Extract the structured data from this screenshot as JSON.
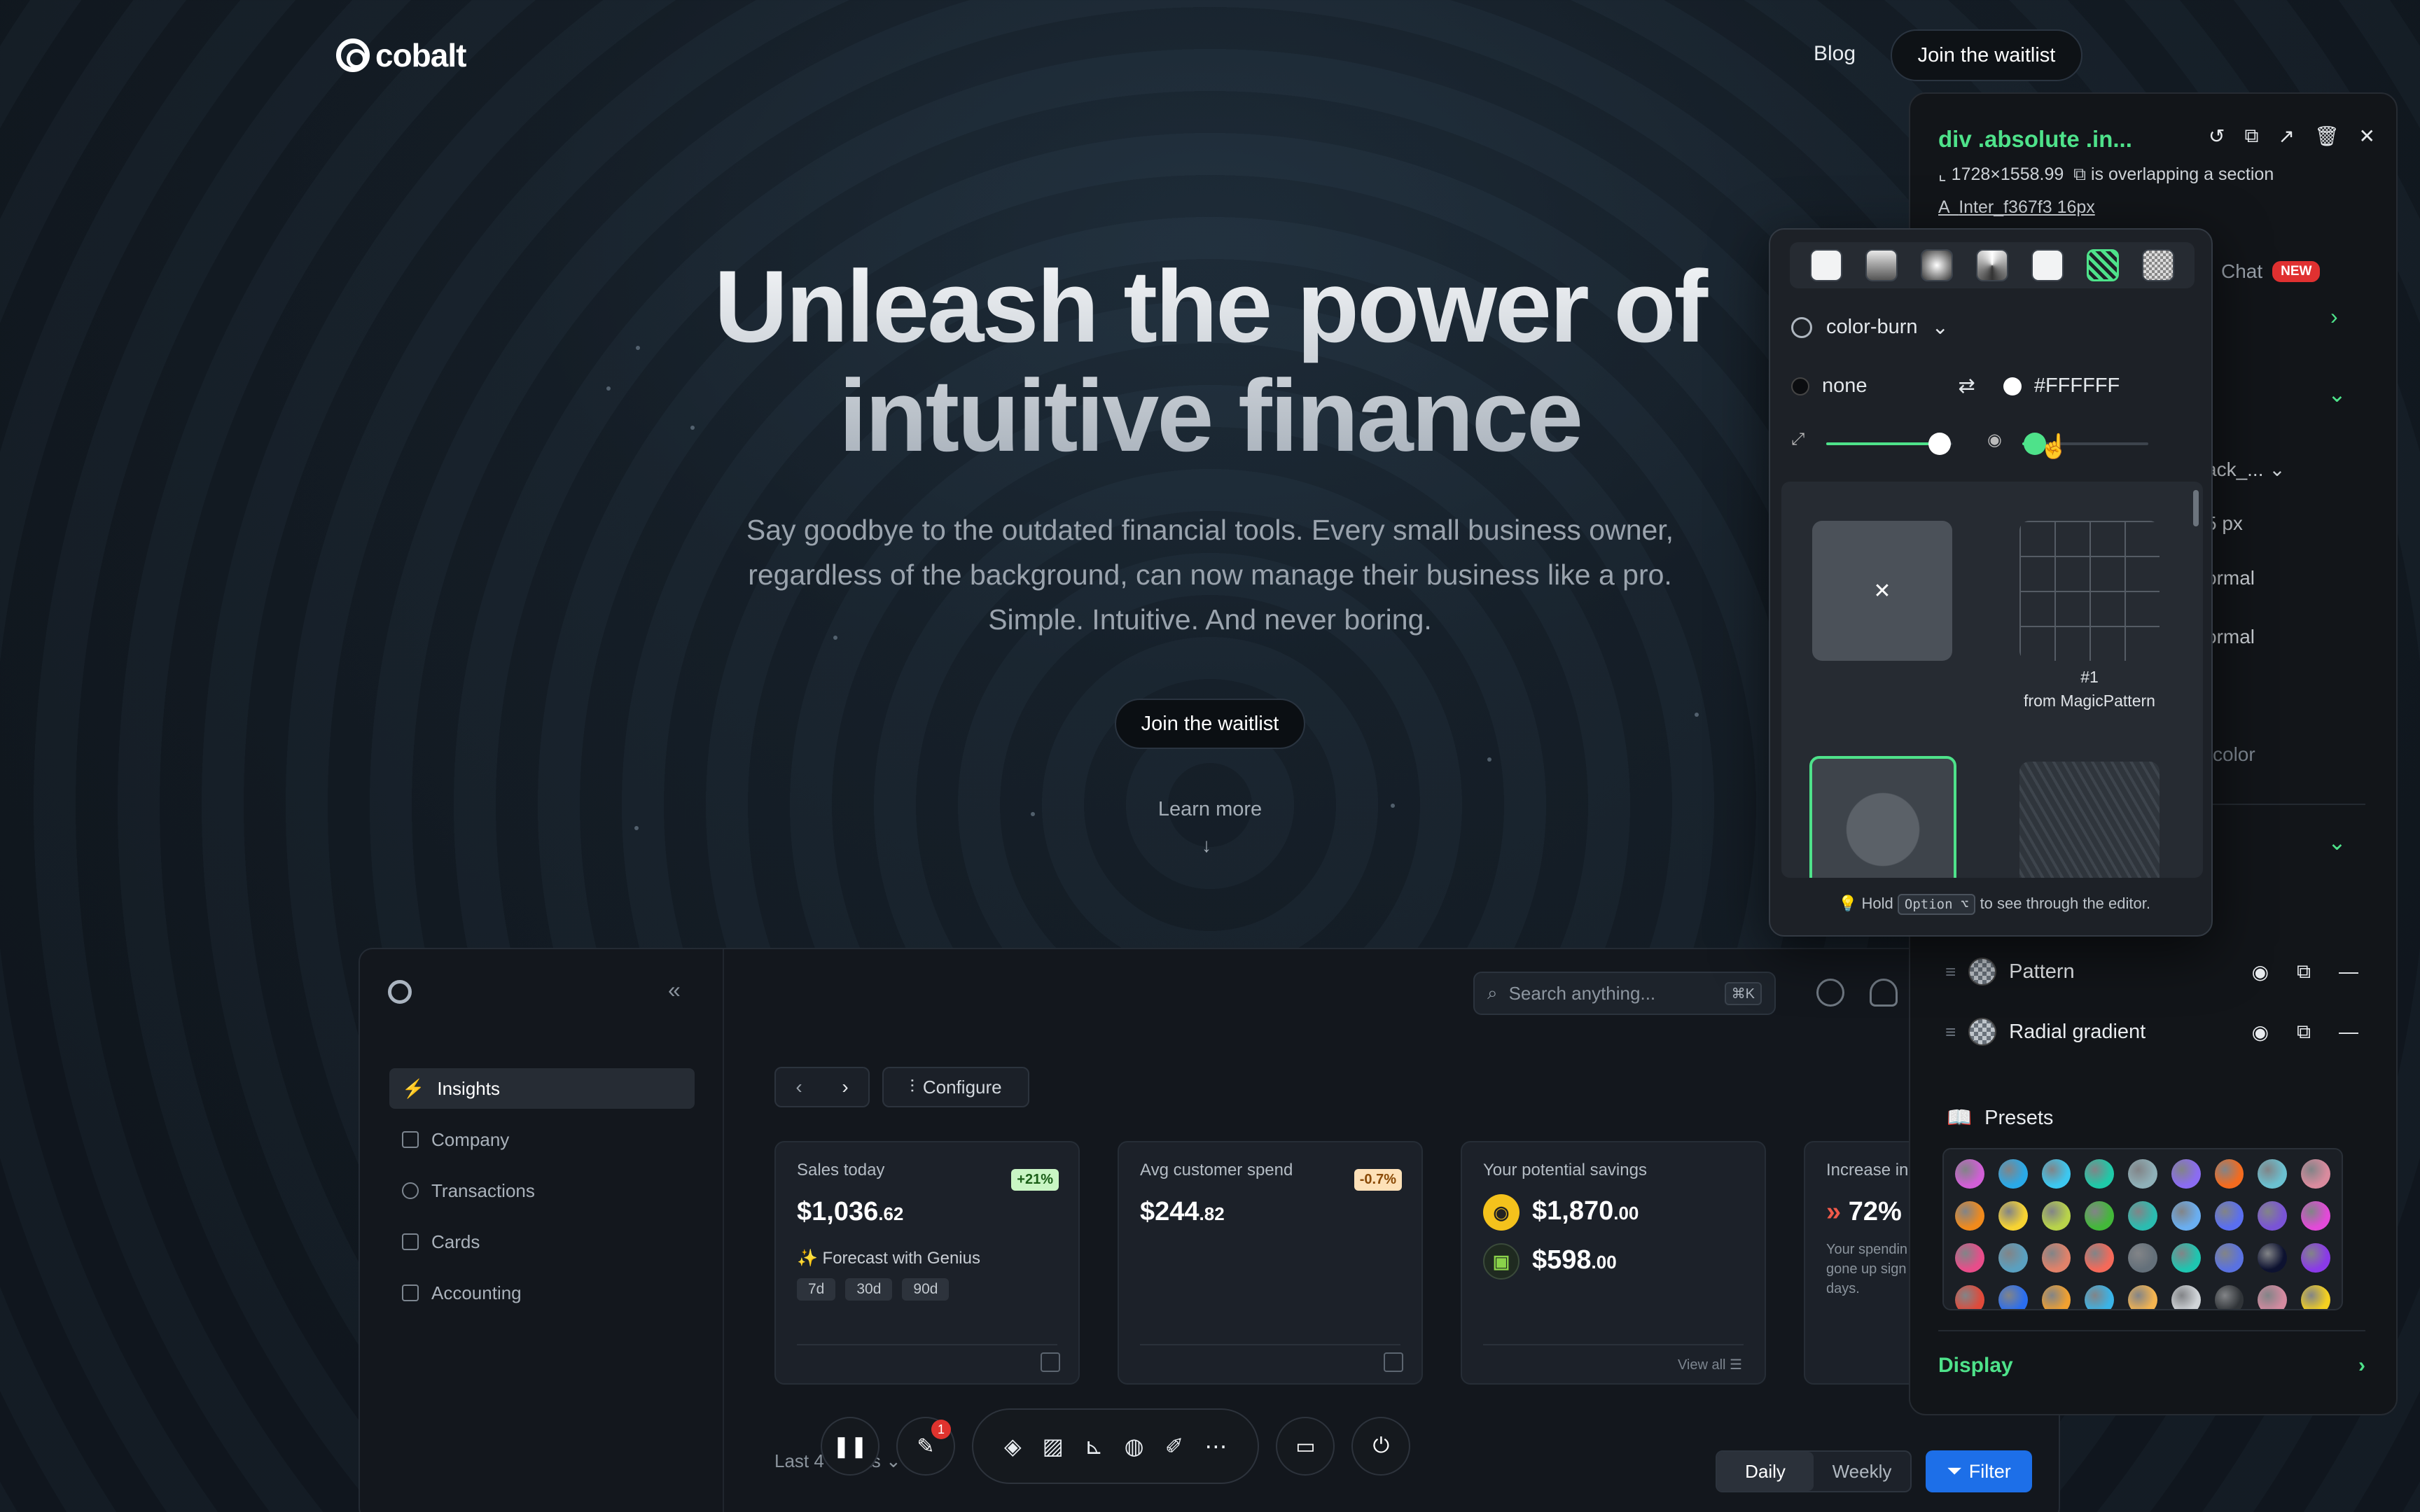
{
  "nav": {
    "logo": "cobalt",
    "blog": "Blog",
    "join": "Join the waitlist"
  },
  "hero": {
    "title_line1": "Unleash the power of",
    "title_line2": "intuitive finance",
    "sub_line1": "Say goodbye to the outdated financial tools. Every small business owner,",
    "sub_line2": "regardless of the background, can now manage their business like a pro.",
    "sub_line3": "Simple. Intuitive. And never boring.",
    "cta": "Join the waitlist",
    "learn": "Learn more"
  },
  "dashboard": {
    "sidebar": [
      "Insights",
      "Company",
      "Transactions",
      "Cards",
      "Accounting"
    ],
    "search_placeholder": "Search anything...",
    "search_kbd": "⌘K",
    "configure": "Configure",
    "cards": [
      {
        "title": "Sales today",
        "badge": "+21%",
        "value": "$1,036",
        "cents": ".62",
        "genius": "✨ Forecast with Genius",
        "chips": [
          "7d",
          "30d",
          "90d"
        ]
      },
      {
        "title": "Avg customer spend",
        "badge": "-0.7%",
        "value": "$244",
        "cents": ".82"
      },
      {
        "title": "Your potential savings",
        "v1": "$1,870",
        "c1": ".00",
        "v2": "$598",
        "c2": ".00",
        "view_all": "View all"
      },
      {
        "title": "Increase in",
        "value": "72%",
        "desc1": "Your spendin",
        "desc2": "gone up sign",
        "desc3": "days."
      }
    ],
    "range": "Last 4 weeks",
    "seg": [
      "Daily",
      "Weekly"
    ],
    "filter": "Filter"
  },
  "toolbar": {
    "notif": "1"
  },
  "inspector": {
    "title": "div .absolute .in...",
    "size": "1728×1558.99",
    "overlap": "is overlapping a section",
    "font": "Inter_f367f3 16px",
    "chat": "Chat",
    "new": "NEW",
    "frag_back": "ack_...",
    "frag_px": "5 px",
    "frag_normal1": "ormal",
    "frag_normal2": "ormal",
    "frag_color": "color",
    "layers": [
      "Pattern",
      "Radial gradient"
    ],
    "presets": "Presets",
    "display": "Display",
    "swatch_colors": [
      [
        "#d15fd6",
        "#2aa9e8",
        "#3cc7f0",
        "#1fc9a8",
        "#8fb0b8",
        "#8b6cf2",
        "#f36b1f",
        "#6bc0d0",
        "#d98b9e"
      ],
      [
        "#f08a1c",
        "#f7d332",
        "#b8d34a",
        "#43b83a",
        "#2bbcb0",
        "#6aaef0",
        "#5a6ff0",
        "#7a54d6",
        "#e24ad8"
      ],
      [
        "#e84d8a",
        "#5aa0c0",
        "#e0826a",
        "#f46a5a",
        "#64707a",
        "#1fc5b0",
        "#5a72e0",
        "#0d1230",
        "#8a3ae8"
      ],
      [
        "#e04a3a",
        "#2a6ef0",
        "#f0a030",
        "#3ab4e8",
        "#f4b450",
        "#d0d4d8",
        "#303438",
        "#d48aa0",
        "#f4d020"
      ]
    ]
  },
  "popup": {
    "blend": "color-burn",
    "none": "none",
    "color": "#FFFFFF",
    "pattern_num": "#1",
    "pattern_src": "from MagicPattern",
    "hint_pre": "Hold",
    "hint_key": "Option ⌥",
    "hint_post": "to see through the editor.",
    "scale": 0.9,
    "opacity": 0.1
  }
}
